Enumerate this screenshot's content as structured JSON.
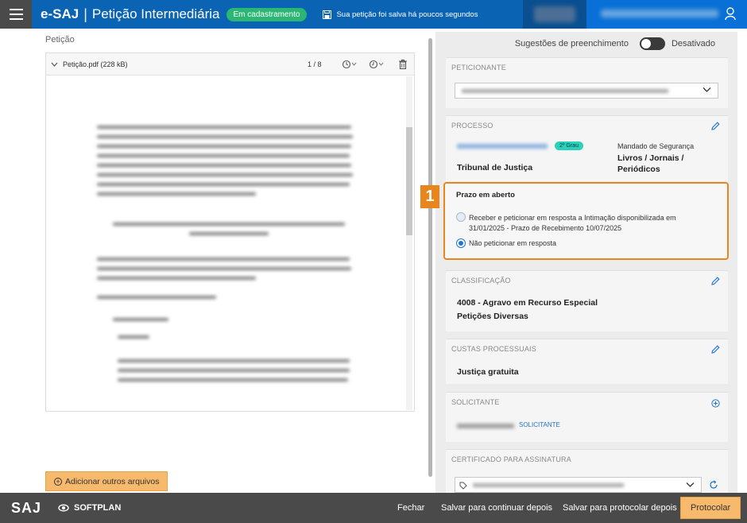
{
  "header": {
    "app_name": "e-SAJ",
    "separator": "|",
    "title": "Petição Intermediária",
    "status_badge": "Em cadastramento",
    "save_status": "Sua petição foi salva há poucos segundos"
  },
  "left": {
    "section_label": "Petição",
    "file_name": "Petição.pdf (228 kB)",
    "page_indicator": "1 / 8",
    "add_files_label": "Adicionar outros arquivos"
  },
  "right": {
    "suggestions_label": "Sugestões de preenchimento",
    "suggestions_state": "Desativado",
    "peticionante": {
      "title": "PETICIONANTE"
    },
    "processo": {
      "title": "PROCESSO",
      "grau_badge": "2º Grau",
      "tribunal": "Tribunal de Justiça",
      "classe": "Mandado de Segurança",
      "assunto": "Livros / Jornais / Periódicos"
    },
    "prazo": {
      "marker": "1",
      "title": "Prazo em aberto",
      "option1_line1": "Receber e peticionar em resposta a Intimação disponibilizada em",
      "option1_line2": "31/01/2025 - Prazo de Recebimento 10/07/2025",
      "option2": "Não peticionar em resposta"
    },
    "classificacao": {
      "title": "CLASSIFICAÇÃO",
      "line1": "4008 - Agravo em Recurso Especial",
      "line2": "Petições Diversas"
    },
    "custas": {
      "title": "CUSTAS PROCESSUAIS",
      "value": "Justiça gratuita"
    },
    "solicitante": {
      "title": "SOLICITANTE",
      "link": "SOLICITANTE"
    },
    "certificado": {
      "title": "CERTIFICADO PARA ASSINATURA"
    }
  },
  "footer": {
    "logo_saj": "SAJ",
    "logo_softplan": "SOFTPLAN",
    "close_label": "Fechar",
    "save_continue_label": "Salvar para continuar depois",
    "save_protocol_label": "Salvar para protocolar depois",
    "protocol_label": "Protocolar"
  },
  "colors": {
    "header_blue": "#0a63b3",
    "badge_green": "#2bb673",
    "highlight_orange": "#e8851b",
    "primary_button": "#f7b96b",
    "link_blue": "#1e73d2"
  }
}
